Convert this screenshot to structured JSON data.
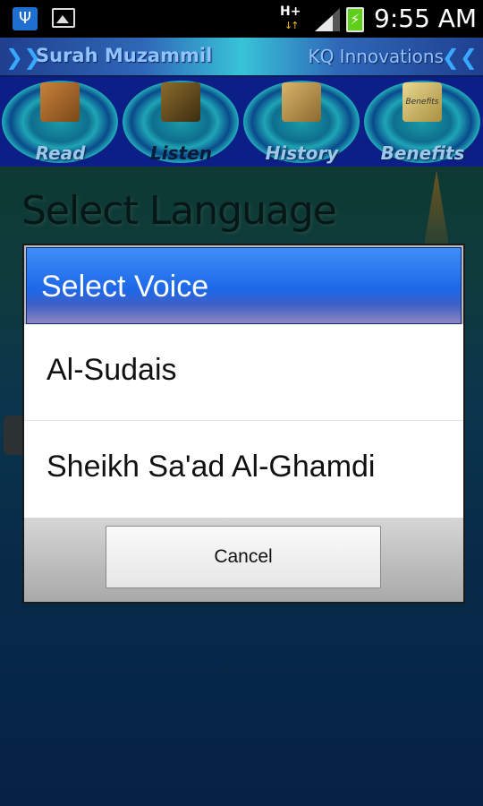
{
  "status_bar": {
    "time": "9:55 AM",
    "network": "H+",
    "icons": [
      "usb-icon",
      "image-icon",
      "data-arrows-icon",
      "signal-icon",
      "battery-charging-icon"
    ]
  },
  "title_bar": {
    "app_name": "Surah Muzammil",
    "brand": "KQ Innovations"
  },
  "nav": {
    "items": [
      {
        "label": "Read",
        "icon": "book-icon"
      },
      {
        "label": "Listen",
        "icon": "headphones-icon"
      },
      {
        "label": "History",
        "icon": "scroll-icon"
      },
      {
        "label": "Benefits",
        "icon": "note-icon",
        "icon_text": "Benefits"
      }
    ],
    "active": "Listen"
  },
  "background": {
    "title": "Select Language"
  },
  "dialog": {
    "title": "Select Voice",
    "options": [
      "Al-Sudais",
      "Sheikh Sa'ad Al-Ghamdi"
    ],
    "cancel_label": "Cancel"
  },
  "colors": {
    "dialog_header": "#1d68e8",
    "nav_background": "#0b1f86",
    "battery": "#5fcf1a"
  }
}
